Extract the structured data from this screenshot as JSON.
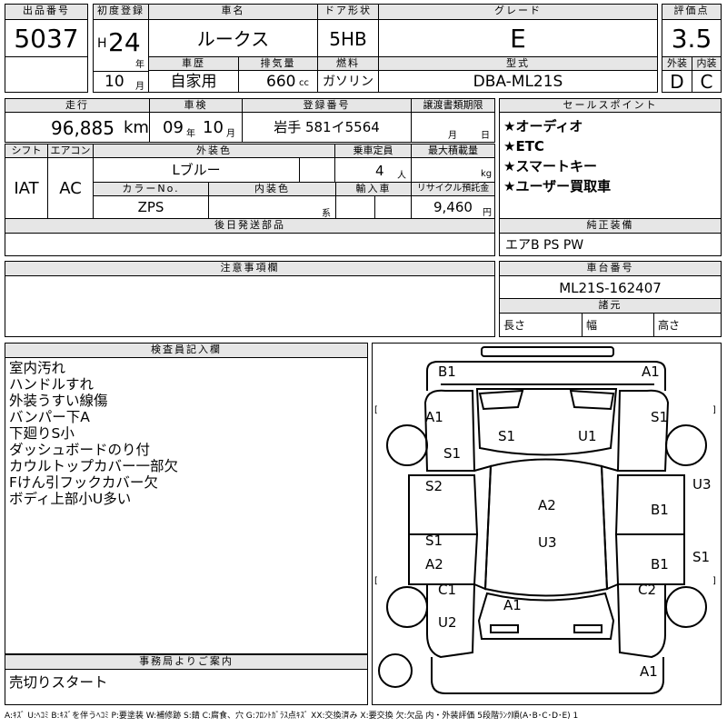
{
  "header": {
    "lot_no_label": "出品番号",
    "lot_no": "5037",
    "first_reg_label": "初度登録",
    "era_letter": "H",
    "year": "24",
    "year_unit": "年",
    "month": "10",
    "month_unit": "月",
    "car_name_label": "車名",
    "car_name": "ルークス",
    "door_label": "ドア形状",
    "door": "5HB",
    "grade_label": "グレード",
    "grade": "E",
    "score_label": "評価点",
    "score": "3.5",
    "history_label": "車歴",
    "history": "自家用",
    "displacement_label": "排気量",
    "displacement": "660",
    "displacement_unit": "cc",
    "fuel_label": "燃料",
    "fuel": "ガソリン",
    "model_label": "型式",
    "model": "DBA-ML21S",
    "exterior_label": "外装",
    "exterior_score": "D",
    "interior_label": "内装",
    "interior_score": "C"
  },
  "row2": {
    "mileage_label": "走行",
    "mileage": "96,885",
    "mileage_unit": "km",
    "inspection_label": "車検",
    "insp_year": "09",
    "insp_year_unit": "年",
    "insp_month": "10",
    "insp_month_unit": "月",
    "reg_no_label": "登録番号",
    "reg_no": "岩手 581イ5564",
    "transfer_label": "譲渡書類期限",
    "transfer_month_unit": "月",
    "transfer_day_unit": "日",
    "sales_points_label": "セールスポイント",
    "sales_points": [
      "★オーディオ",
      "★ETC",
      "★スマートキー",
      "★ユーザー買取車"
    ]
  },
  "row3": {
    "shift_label": "シフト",
    "shift": "IAT",
    "ac_label": "エアコン",
    "ac": "AC",
    "ext_color_label": "外装色",
    "ext_color": "Lブルー",
    "capacity_label": "乗車定員",
    "capacity": "4",
    "capacity_unit": "人",
    "load_label": "最大積載量",
    "load_unit": "kg",
    "color_no_label": "カラーNo.",
    "color_no": "ZPS",
    "int_color_label": "内装色",
    "int_color_unit": "系",
    "import_label": "輸入車",
    "recycle_label": "リサイクル預託金",
    "recycle": "9,460",
    "recycle_unit": "円"
  },
  "later_parts_label": "後日発送部品",
  "genuine_label": "純正装備",
  "genuine": "エアB PS PW",
  "notes_label": "注意事項欄",
  "chassis_label": "車台番号",
  "chassis": "ML21S-162407",
  "spec_label": "諸元",
  "length_label": "長さ",
  "width_label": "幅",
  "height_label": "高さ",
  "inspector_label": "検査員記入欄",
  "inspector_notes": [
    "室内汚れ",
    "ハンドルすれ",
    "外装うすい線傷",
    "バンパー下A",
    "下廻りS小",
    "ダッシュボードのり付",
    "カウルトップカバー一部欠",
    "Fけん引フックカバー欠",
    "ボディ上部小U多い"
  ],
  "office_label": "事務局よりご案内",
  "office_note": "売切りスタート",
  "legend": "A:ｷｽﾞ U:ﾍｺﾐ B:ｷｽﾞを伴うﾍｺﾐ P:要塗装 W:補修跡 S:錆 C:腐食、穴 G:ﾌﾛﾝﾄｶﾞﾗｽ点ｷｽﾞ XX:交換済み X:要交換 欠:欠品 内・外装評価 5段階ﾗﾝｸ順(A･B･C･D･E) 1",
  "diagram": {
    "marks": {
      "b1_top": "B1",
      "a1_top": "A1",
      "a1_left": "A1",
      "s1_right": "S1",
      "s1_hood_l": "S1",
      "u1_hood": "U1",
      "s1_fender_l": "S1",
      "u3_right": "U3",
      "s2_door": "S2",
      "a2_roof": "A2",
      "b1_door_r": "B1",
      "u3_roof": "U3",
      "s1_rdoor_l": "S1",
      "a2_rdoor_l": "A2",
      "b1_rdoor_r": "B1",
      "s1_far_right": "S1",
      "c1_left": "C1",
      "c2_right": "C2",
      "a1_trunk": "A1",
      "u2_left": "U2",
      "a1_bottom": "A1"
    }
  }
}
